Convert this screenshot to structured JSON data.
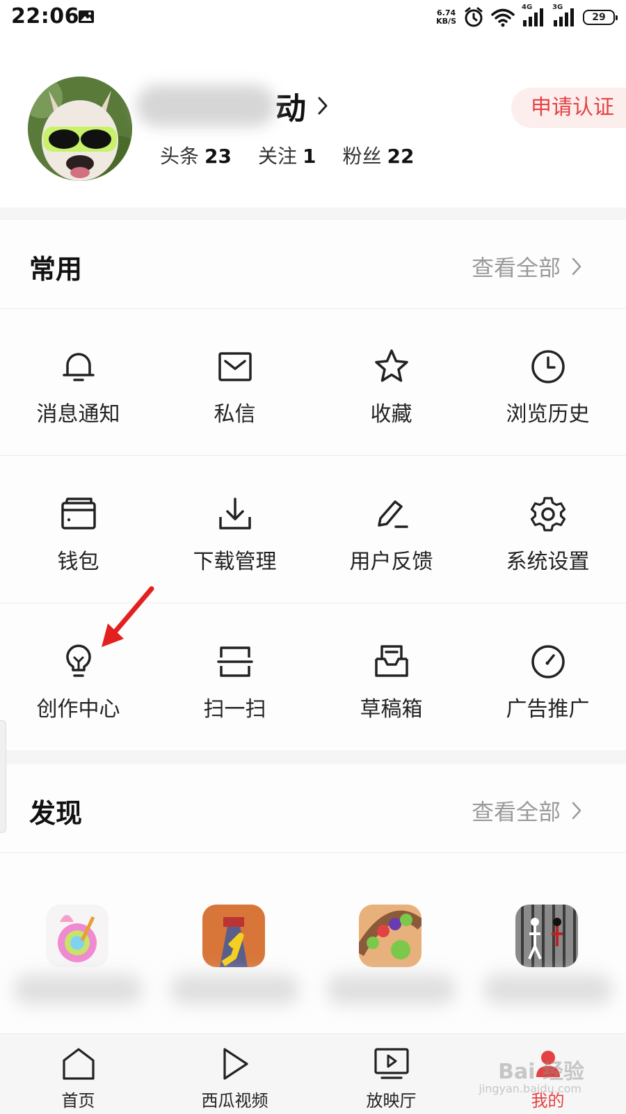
{
  "status_bar": {
    "time": "22:06",
    "net_speed_value": "6.74",
    "net_speed_unit": "KB/S",
    "sig1_label": "4G",
    "sig2_label": "3G",
    "battery": "29",
    "icons": [
      "image-icon",
      "alarm-icon",
      "wifi-icon",
      "signal-4g-icon",
      "signal-3g-icon",
      "battery-icon"
    ]
  },
  "profile": {
    "name_visible_part": "动",
    "verify_label": "申请认证",
    "stats": [
      {
        "label": "头条",
        "value": "23"
      },
      {
        "label": "关注",
        "value": "1"
      },
      {
        "label": "粉丝",
        "value": "22"
      }
    ]
  },
  "common": {
    "title": "常用",
    "see_all": "查看全部",
    "items": [
      {
        "label": "消息通知",
        "icon": "bell-icon"
      },
      {
        "label": "私信",
        "icon": "mail-icon"
      },
      {
        "label": "收藏",
        "icon": "star-icon"
      },
      {
        "label": "浏览历史",
        "icon": "clock-icon"
      },
      {
        "label": "钱包",
        "icon": "wallet-icon"
      },
      {
        "label": "下载管理",
        "icon": "download-icon"
      },
      {
        "label": "用户反馈",
        "icon": "pen-icon"
      },
      {
        "label": "系统设置",
        "icon": "gear-icon"
      },
      {
        "label": "创作中心",
        "icon": "lightbulb-icon"
      },
      {
        "label": "扫一扫",
        "icon": "scan-icon"
      },
      {
        "label": "草稿箱",
        "icon": "draft-box-icon"
      },
      {
        "label": "广告推广",
        "icon": "gauge-icon"
      }
    ]
  },
  "discover": {
    "title": "发现",
    "see_all": "查看全部"
  },
  "bottom_nav": [
    {
      "label": "首页",
      "icon": "home-icon"
    },
    {
      "label": "西瓜视频",
      "icon": "play-icon"
    },
    {
      "label": "放映厅",
      "icon": "tv-play-icon"
    },
    {
      "label": "我的",
      "icon": "profile-icon",
      "active": true
    }
  ],
  "watermark": {
    "main": "Bai 经验",
    "sub": "jingyan.baidu.com"
  },
  "colors": {
    "accent": "#e34242",
    "verify_bg": "#fdeeee",
    "muted_text": "#9a9a9a"
  }
}
